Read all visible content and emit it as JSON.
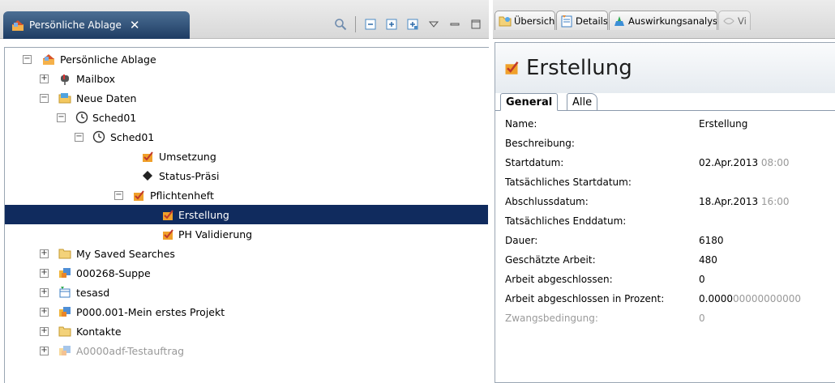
{
  "left_panel": {
    "tab_title": "Persönliche Ablage",
    "close_glyph": "✕",
    "toolbar_icons": [
      "search-icon",
      "collapse-all-icon",
      "expand-icon",
      "expand-all-icon",
      "view-menu-icon",
      "minimize-icon",
      "maximize-icon"
    ]
  },
  "tree": {
    "items": [
      {
        "label": "Persönliche Ablage",
        "icon": "home-folder-icon",
        "expander": "−"
      },
      {
        "label": "Mailbox",
        "icon": "mailbox-icon",
        "expander": "+"
      },
      {
        "label": "Neue Daten",
        "icon": "folder-new-icon",
        "expander": "−"
      },
      {
        "label": "Sched01",
        "icon": "clock-icon",
        "expander": "−"
      },
      {
        "label": "Sched01",
        "icon": "clock-icon",
        "expander": "−"
      },
      {
        "label": "Umsetzung",
        "icon": "task-icon",
        "expander": ""
      },
      {
        "label": "Status-Präsi",
        "icon": "milestone-icon",
        "expander": ""
      },
      {
        "label": "Pflichtenheft",
        "icon": "task-icon",
        "expander": "−"
      },
      {
        "label": "Erstellung",
        "icon": "task-icon",
        "expander": ""
      },
      {
        "label": "PH Validierung",
        "icon": "task-icon",
        "expander": ""
      },
      {
        "label": "My Saved Searches",
        "icon": "folder-icon",
        "expander": "+"
      },
      {
        "label": "000268-Suppe",
        "icon": "project-icon",
        "expander": "+"
      },
      {
        "label": "tesasd",
        "icon": "schedule-icon",
        "expander": "+"
      },
      {
        "label": "P000.001-Mein erstes Projekt",
        "icon": "project-icon",
        "expander": "+"
      },
      {
        "label": "Kontakte",
        "icon": "folder-icon",
        "expander": "+"
      },
      {
        "label": "A0000adf-Testauftrag",
        "icon": "project-icon",
        "expander": "+"
      }
    ]
  },
  "right_panel": {
    "tabs": [
      {
        "label": "Übersicht",
        "icon": "overview-icon"
      },
      {
        "label": "Details",
        "icon": "details-icon"
      },
      {
        "label": "Auswirkungsanalyse",
        "icon": "impact-analysis-icon"
      },
      {
        "label": "Vi",
        "icon": "view-icon"
      }
    ],
    "editor_title": "Erstellung",
    "subtabs": [
      "General",
      "Alle"
    ],
    "properties": [
      {
        "name": "Name:",
        "value": "Erstellung",
        "value_faded": ""
      },
      {
        "name": "Beschreibung:",
        "value": "",
        "value_faded": ""
      },
      {
        "name": "Startdatum:",
        "value": "02.Apr.2013",
        "value_faded": " 08:00"
      },
      {
        "name": "Tatsächliches Startdatum:",
        "value": "",
        "value_faded": ""
      },
      {
        "name": "Abschlussdatum:",
        "value": "18.Apr.2013",
        "value_faded": " 16:00"
      },
      {
        "name": "Tatsächliches Enddatum:",
        "value": "",
        "value_faded": ""
      },
      {
        "name": "Dauer:",
        "value": "6180",
        "value_faded": ""
      },
      {
        "name": "Geschätzte Arbeit:",
        "value": "480",
        "value_faded": ""
      },
      {
        "name": "Arbeit abgeschlossen:",
        "value": "0",
        "value_faded": ""
      },
      {
        "name": "Arbeit abgeschlossen in Prozent:",
        "value": "0.0000",
        "value_faded": "00000000000"
      },
      {
        "name": "Zwangsbedingung:",
        "value": "0",
        "value_faded": ""
      }
    ]
  },
  "colors": {
    "selection": "#102b5e",
    "tab_active": "#1e3c63",
    "task_icon": "#f0a02a"
  }
}
